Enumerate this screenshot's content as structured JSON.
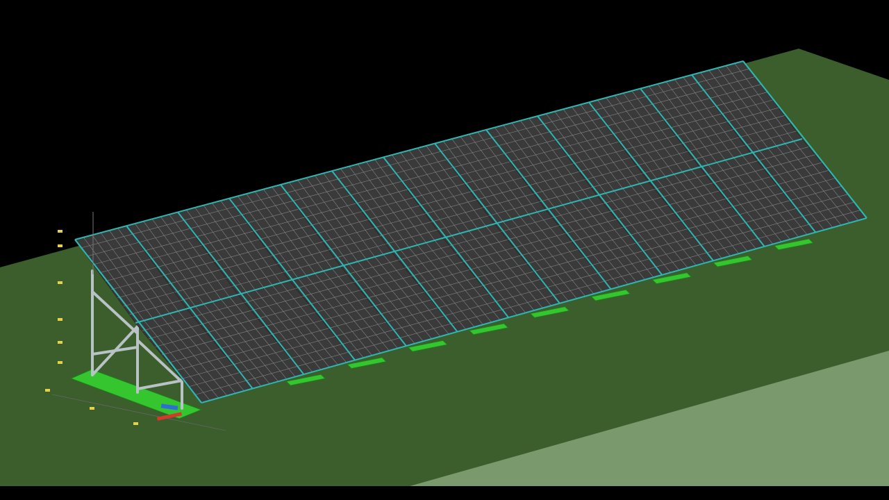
{
  "scene": {
    "description_visible_text": [],
    "colors": {
      "background": "#000000",
      "ground_dark": "#3b5e2c",
      "ground_light": "#7a9a6e",
      "panel_fill": "#3a3a3a",
      "panel_grid": "#9aa09e",
      "frame_rail": "#2fb6b2",
      "steel_post": "#b9c2c4",
      "footing": "#35c52f",
      "footing_edge": "#1f7d1c",
      "axis_x": "#d43a2b",
      "axis_y": "#2f6fd4",
      "dimension_mark": "#e6d24a"
    },
    "array": {
      "modules_along_length_per_row": 13,
      "rows": 2,
      "support_footings_visible": 9
    }
  }
}
